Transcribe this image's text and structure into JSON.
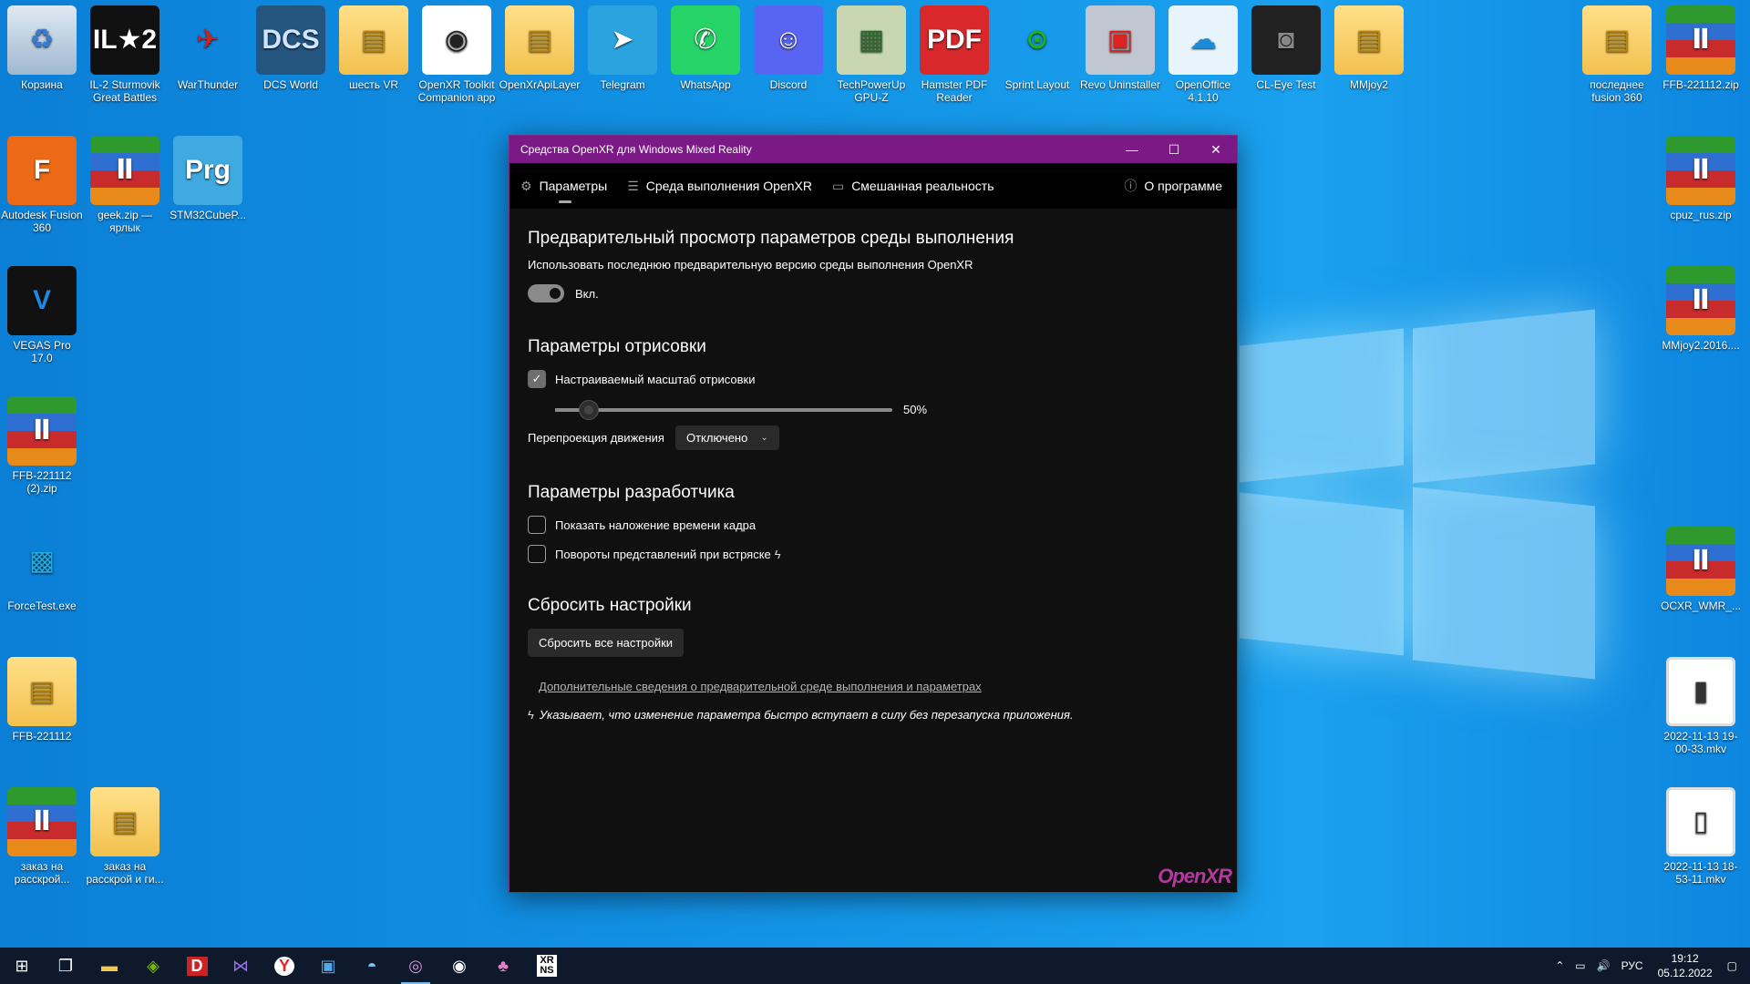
{
  "desktop": {
    "icons": [
      {
        "id": "recycle",
        "label": "Корзина",
        "glyph": "♻"
      },
      {
        "id": "il2",
        "label": "IL-2 Sturmovik Great Battles",
        "glyph": "IL★2"
      },
      {
        "id": "warthunder",
        "label": "WarThunder",
        "glyph": "✈"
      },
      {
        "id": "dcs",
        "label": "DCS World",
        "glyph": "DCS"
      },
      {
        "id": "shest",
        "label": "шесть VR",
        "glyph": "▤"
      },
      {
        "id": "openxrtoolkit",
        "label": "OpenXR Toolkit Companion app",
        "glyph": "◉"
      },
      {
        "id": "openxrapilayer",
        "label": "OpenXrApiLayer",
        "glyph": "▤"
      },
      {
        "id": "telegram",
        "label": "Telegram",
        "glyph": "➤"
      },
      {
        "id": "whatsapp",
        "label": "WhatsApp",
        "glyph": "✆"
      },
      {
        "id": "discord",
        "label": "Discord",
        "glyph": "☺"
      },
      {
        "id": "gpuz",
        "label": "TechPowerUp GPU-Z",
        "glyph": "▦"
      },
      {
        "id": "hamsterpdf",
        "label": "Hamster PDF Reader",
        "glyph": "PDF"
      },
      {
        "id": "sprintlayout",
        "label": "Sprint Layout",
        "glyph": "⊙"
      },
      {
        "id": "revo",
        "label": "Revo Uninstaller",
        "glyph": "▣"
      },
      {
        "id": "openoffice",
        "label": "OpenOffice 4.1.10",
        "glyph": "☁"
      },
      {
        "id": "cleyetest",
        "label": "CL-Eye Test",
        "glyph": "◙"
      },
      {
        "id": "mmjoy2",
        "label": "MMjoy2",
        "glyph": "▤"
      },
      {
        "id": "poslednee",
        "label": "последнее fusion 360",
        "glyph": "▤"
      },
      {
        "id": "ffbzip",
        "label": "FFB-221112.zip",
        "glyph": "Ⅱ"
      },
      {
        "id": "fusion360",
        "label": "Autodesk Fusion 360",
        "glyph": "F"
      },
      {
        "id": "geekzip",
        "label": "geek.zip — ярлык",
        "glyph": "Ⅱ"
      },
      {
        "id": "stm32",
        "label": "STM32CubeP...",
        "glyph": "Prg"
      },
      {
        "id": "cpuzzip",
        "label": "cpuz_rus.zip",
        "glyph": "Ⅱ"
      },
      {
        "id": "vegas",
        "label": "VEGAS Pro 17.0",
        "glyph": "V"
      },
      {
        "id": "mmjoyzip",
        "label": "MMjoy2.2016....",
        "glyph": "Ⅱ"
      },
      {
        "id": "ffb2zip",
        "label": "FFB-221112 (2).zip",
        "glyph": "Ⅱ"
      },
      {
        "id": "forcetest",
        "label": "ForceTest.exe",
        "glyph": "▩"
      },
      {
        "id": "ocxr",
        "label": "OCXR_WMR_...",
        "glyph": "Ⅱ"
      },
      {
        "id": "ffbfolder",
        "label": "FFB-221112",
        "glyph": "▤"
      },
      {
        "id": "video1",
        "label": "2022-11-13 19-00-33.mkv",
        "glyph": "▮"
      },
      {
        "id": "zakaz1",
        "label": "заказ на расскрой...",
        "glyph": "Ⅱ"
      },
      {
        "id": "zakaz2",
        "label": "заказ на расскрой и ги...",
        "glyph": "▤"
      },
      {
        "id": "video2",
        "label": "2022-11-13 18-53-11.mkv",
        "glyph": "▯"
      }
    ]
  },
  "window": {
    "title": "Средства OpenXR для Windows Mixed Reality",
    "controls": {
      "minimize": "—",
      "maximize": "☐",
      "close": "✕"
    },
    "nav": {
      "settings": "Параметры",
      "runtime": "Среда выполнения OpenXR",
      "mixed": "Смешанная реальность",
      "about": "О программе"
    },
    "preview": {
      "heading": "Предварительный просмотр параметров среды выполнения",
      "description": "Использовать последнюю предварительную версию среды выполнения OpenXR",
      "toggle_label": "Вкл.",
      "toggle_on": true
    },
    "render": {
      "heading": "Параметры отрисовки",
      "custom_scale_label": "Настраиваемый масштаб отрисовки",
      "custom_scale_checked": true,
      "scale_value": "50%",
      "scale_fraction": 0.1,
      "reprojection_label": "Перепроекция движения",
      "reprojection_value": "Отключено"
    },
    "developer": {
      "heading": "Параметры разработчика",
      "frame_overlay_label": "Показать наложение времени кадра",
      "shake_label": "Повороты представлений при встряске"
    },
    "reset": {
      "heading": "Сбросить настройки",
      "button": "Сбросить все настройки"
    },
    "link": "Дополнительные сведения о предварительной среде выполнения и параметрах",
    "note": "Указывает, что изменение параметра быстро вступает в силу без перезапуска приложения.",
    "logo": "OpenXR"
  },
  "taskbar": {
    "tray": {
      "chevron": "⌃",
      "network": "▭",
      "volume": "🔊",
      "lang": "РУС",
      "time": "19:12",
      "date": "05.12.2022",
      "notify": "▢"
    }
  }
}
